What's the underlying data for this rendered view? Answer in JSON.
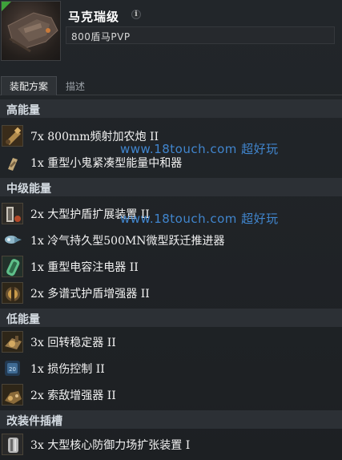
{
  "header": {
    "title": "马克瑞级",
    "info_glyph": "i",
    "fitting_name": "800盾马PVP"
  },
  "tabs": [
    {
      "label": "装配方案"
    },
    {
      "label": "描述"
    }
  ],
  "sections": [
    {
      "title": "高能量",
      "items": [
        {
          "label": "7x 800mm频射加农炮 II",
          "icon": "artillery-icon"
        },
        {
          "label": "1x 重型小鬼紧凑型能量中和器",
          "icon": "energy-neutralizer-icon"
        }
      ]
    },
    {
      "title": "中级能量",
      "items": [
        {
          "label": "2x 大型护盾扩展装置 II",
          "icon": "shield-extender-icon"
        },
        {
          "label": "1x 冷气持久型500MN微型跃迁推进器",
          "icon": "microwarpdrive-icon"
        },
        {
          "label": "1x 重型电容注电器 II",
          "icon": "capacitor-booster-icon"
        },
        {
          "label": "2x 多谱式护盾增强器 II",
          "icon": "shield-hardener-icon"
        }
      ]
    },
    {
      "title": "低能量",
      "items": [
        {
          "label": "3x 回转稳定器 II",
          "icon": "gyrostabilizer-icon"
        },
        {
          "label": "1x 损伤控制 II",
          "icon": "damage-control-icon"
        },
        {
          "label": "2x 索敌增强器 II",
          "icon": "tracking-enhancer-icon"
        }
      ]
    },
    {
      "title": "改装件插槽",
      "items": [
        {
          "label": "3x 大型核心防御力场扩张装置 I",
          "icon": "rig-icon"
        }
      ]
    }
  ],
  "watermarks": [
    {
      "text": "www.18touch.com  超好玩"
    },
    {
      "text": "www.18touch.com  超好玩"
    }
  ],
  "colors": {
    "background": "#1b1e21",
    "section_header": "#2c3035",
    "watermark": "#4696eb",
    "ribbon": "#3ea23a"
  }
}
